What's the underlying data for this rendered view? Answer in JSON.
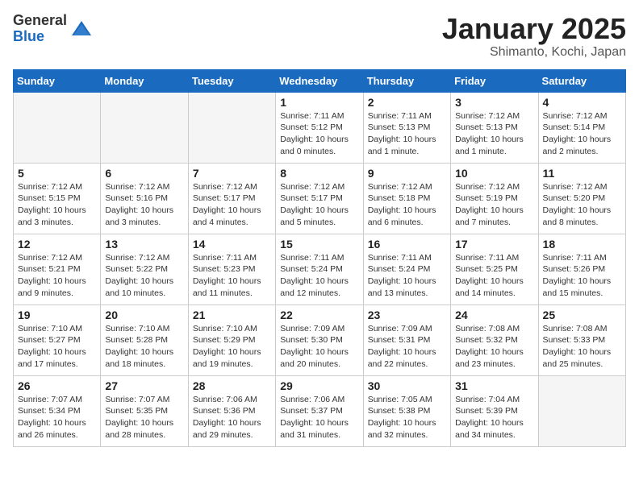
{
  "logo": {
    "general": "General",
    "blue": "Blue"
  },
  "header": {
    "title": "January 2025",
    "subtitle": "Shimanto, Kochi, Japan"
  },
  "weekdays": [
    "Sunday",
    "Monday",
    "Tuesday",
    "Wednesday",
    "Thursday",
    "Friday",
    "Saturday"
  ],
  "weeks": [
    [
      {
        "day": "",
        "empty": true
      },
      {
        "day": "",
        "empty": true
      },
      {
        "day": "",
        "empty": true
      },
      {
        "day": "1",
        "sunrise": "7:11 AM",
        "sunset": "5:12 PM",
        "daylight": "10 hours and 0 minutes."
      },
      {
        "day": "2",
        "sunrise": "7:11 AM",
        "sunset": "5:13 PM",
        "daylight": "10 hours and 1 minute."
      },
      {
        "day": "3",
        "sunrise": "7:12 AM",
        "sunset": "5:13 PM",
        "daylight": "10 hours and 1 minute."
      },
      {
        "day": "4",
        "sunrise": "7:12 AM",
        "sunset": "5:14 PM",
        "daylight": "10 hours and 2 minutes."
      }
    ],
    [
      {
        "day": "5",
        "sunrise": "7:12 AM",
        "sunset": "5:15 PM",
        "daylight": "10 hours and 3 minutes."
      },
      {
        "day": "6",
        "sunrise": "7:12 AM",
        "sunset": "5:16 PM",
        "daylight": "10 hours and 3 minutes."
      },
      {
        "day": "7",
        "sunrise": "7:12 AM",
        "sunset": "5:17 PM",
        "daylight": "10 hours and 4 minutes."
      },
      {
        "day": "8",
        "sunrise": "7:12 AM",
        "sunset": "5:17 PM",
        "daylight": "10 hours and 5 minutes."
      },
      {
        "day": "9",
        "sunrise": "7:12 AM",
        "sunset": "5:18 PM",
        "daylight": "10 hours and 6 minutes."
      },
      {
        "day": "10",
        "sunrise": "7:12 AM",
        "sunset": "5:19 PM",
        "daylight": "10 hours and 7 minutes."
      },
      {
        "day": "11",
        "sunrise": "7:12 AM",
        "sunset": "5:20 PM",
        "daylight": "10 hours and 8 minutes."
      }
    ],
    [
      {
        "day": "12",
        "sunrise": "7:12 AM",
        "sunset": "5:21 PM",
        "daylight": "10 hours and 9 minutes."
      },
      {
        "day": "13",
        "sunrise": "7:12 AM",
        "sunset": "5:22 PM",
        "daylight": "10 hours and 10 minutes."
      },
      {
        "day": "14",
        "sunrise": "7:11 AM",
        "sunset": "5:23 PM",
        "daylight": "10 hours and 11 minutes."
      },
      {
        "day": "15",
        "sunrise": "7:11 AM",
        "sunset": "5:24 PM",
        "daylight": "10 hours and 12 minutes."
      },
      {
        "day": "16",
        "sunrise": "7:11 AM",
        "sunset": "5:24 PM",
        "daylight": "10 hours and 13 minutes."
      },
      {
        "day": "17",
        "sunrise": "7:11 AM",
        "sunset": "5:25 PM",
        "daylight": "10 hours and 14 minutes."
      },
      {
        "day": "18",
        "sunrise": "7:11 AM",
        "sunset": "5:26 PM",
        "daylight": "10 hours and 15 minutes."
      }
    ],
    [
      {
        "day": "19",
        "sunrise": "7:10 AM",
        "sunset": "5:27 PM",
        "daylight": "10 hours and 17 minutes."
      },
      {
        "day": "20",
        "sunrise": "7:10 AM",
        "sunset": "5:28 PM",
        "daylight": "10 hours and 18 minutes."
      },
      {
        "day": "21",
        "sunrise": "7:10 AM",
        "sunset": "5:29 PM",
        "daylight": "10 hours and 19 minutes."
      },
      {
        "day": "22",
        "sunrise": "7:09 AM",
        "sunset": "5:30 PM",
        "daylight": "10 hours and 20 minutes."
      },
      {
        "day": "23",
        "sunrise": "7:09 AM",
        "sunset": "5:31 PM",
        "daylight": "10 hours and 22 minutes."
      },
      {
        "day": "24",
        "sunrise": "7:08 AM",
        "sunset": "5:32 PM",
        "daylight": "10 hours and 23 minutes."
      },
      {
        "day": "25",
        "sunrise": "7:08 AM",
        "sunset": "5:33 PM",
        "daylight": "10 hours and 25 minutes."
      }
    ],
    [
      {
        "day": "26",
        "sunrise": "7:07 AM",
        "sunset": "5:34 PM",
        "daylight": "10 hours and 26 minutes."
      },
      {
        "day": "27",
        "sunrise": "7:07 AM",
        "sunset": "5:35 PM",
        "daylight": "10 hours and 28 minutes."
      },
      {
        "day": "28",
        "sunrise": "7:06 AM",
        "sunset": "5:36 PM",
        "daylight": "10 hours and 29 minutes."
      },
      {
        "day": "29",
        "sunrise": "7:06 AM",
        "sunset": "5:37 PM",
        "daylight": "10 hours and 31 minutes."
      },
      {
        "day": "30",
        "sunrise": "7:05 AM",
        "sunset": "5:38 PM",
        "daylight": "10 hours and 32 minutes."
      },
      {
        "day": "31",
        "sunrise": "7:04 AM",
        "sunset": "5:39 PM",
        "daylight": "10 hours and 34 minutes."
      },
      {
        "day": "",
        "empty": true
      }
    ]
  ],
  "labels": {
    "sunrise": "Sunrise:",
    "sunset": "Sunset:",
    "daylight": "Daylight hours"
  }
}
